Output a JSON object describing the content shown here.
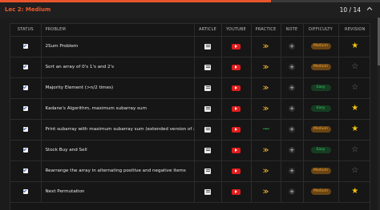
{
  "header": {
    "lecture_title": "Lec 2: Medium",
    "counter": "10 / 14",
    "progress_fraction": 0.714
  },
  "table": {
    "columns": {
      "status": "STATUS",
      "problem": "PROBLEM",
      "article": "ARTICLE",
      "youtube": "YOUTUBE",
      "practice": "PRACTICE",
      "note": "NOTE",
      "difficulty": "DIFFICULTY",
      "revision": "REVISION"
    },
    "rows": [
      {
        "problem": "2Sum Problem",
        "practice_icon": "code-icon",
        "difficulty": "Medium",
        "revision": "starred"
      },
      {
        "problem": "Sort an array of 0's 1's and 2's",
        "practice_icon": "code-icon",
        "difficulty": "Medium",
        "revision": "unstarred"
      },
      {
        "problem": "Majority Element (>n/2 times)",
        "practice_icon": "code-icon",
        "difficulty": "Easy",
        "revision": "unstarred"
      },
      {
        "problem": "Kadane's Algorithm, maximum subarray sum",
        "practice_icon": "code-icon",
        "difficulty": "Easy",
        "revision": "starred"
      },
      {
        "problem": "Print subarray with maximum subarray sum (extended version of above problem)",
        "practice_icon": "gfg-icon",
        "difficulty": "Medium",
        "revision": "starred"
      },
      {
        "problem": "Stock Buy and Sell",
        "practice_icon": "code-icon",
        "difficulty": "Easy",
        "revision": "unstarred"
      },
      {
        "problem": "Rearrange the array in alternating positive and negative items",
        "practice_icon": "code-icon",
        "difficulty": "Medium",
        "revision": "unstarred"
      },
      {
        "problem": "Next Permutation",
        "practice_icon": "code-icon",
        "difficulty": "Medium",
        "revision": "starred"
      }
    ]
  },
  "icons": {
    "article": "article-icon",
    "youtube": "youtube-icon",
    "note": "plus-icon",
    "status": "checkbox-checked-icon",
    "star_filled": "star-filled-icon",
    "star_empty": "star-outline-icon"
  },
  "colors": {
    "accent": "#ee5a2b",
    "medium_badge_bg": "#6a4413",
    "medium_badge_text": "#e8a540",
    "easy_badge_bg": "#163d22",
    "easy_badge_text": "#3ac864",
    "star": "#f1c40f",
    "youtube": "#e21d1d",
    "practice": "#f2b531",
    "gfg": "#2f9e44"
  }
}
